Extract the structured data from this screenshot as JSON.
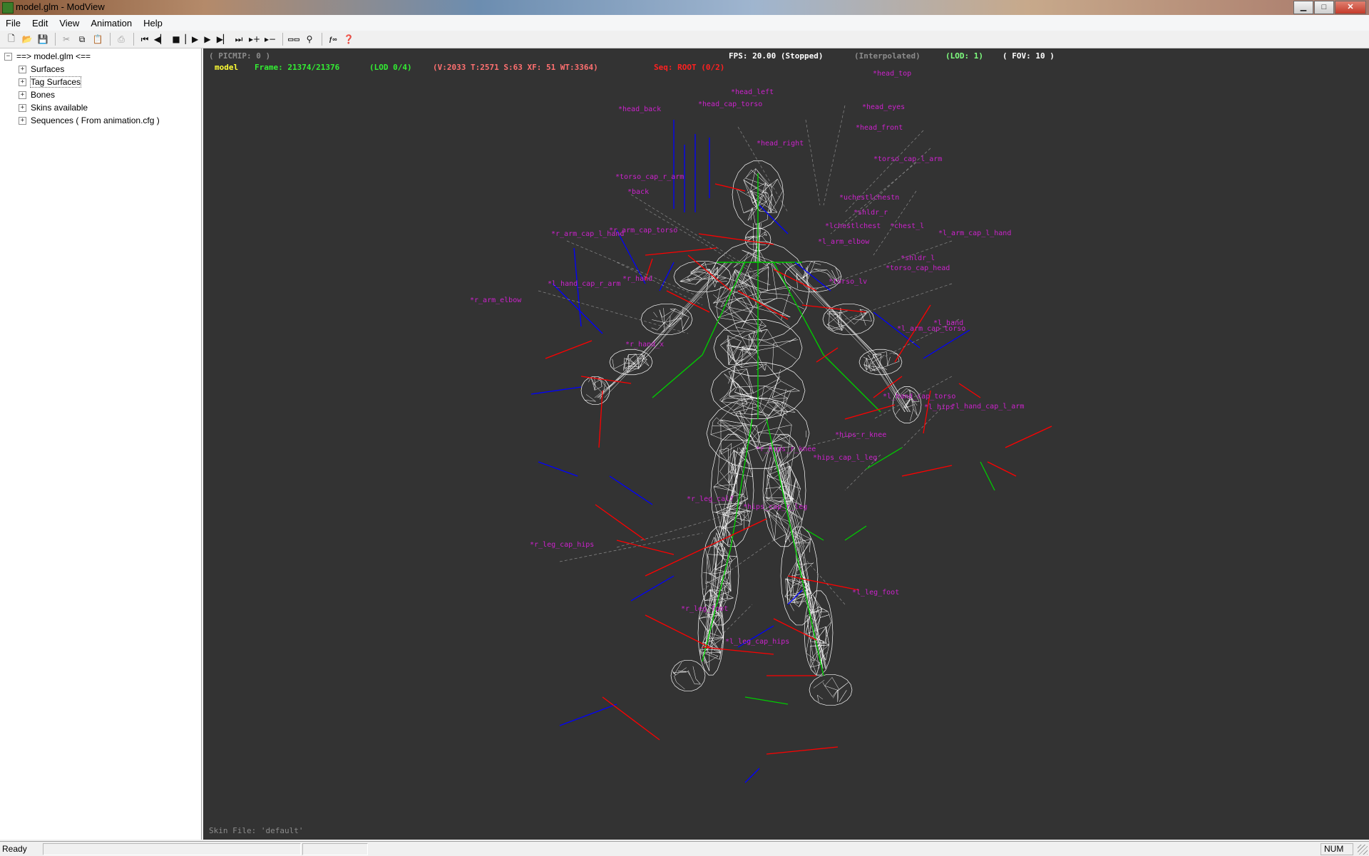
{
  "window": {
    "title": "model.glm - ModView",
    "minimize": "▁",
    "maximize": "□",
    "close": "✕"
  },
  "menu": [
    "File",
    "Edit",
    "View",
    "Animation",
    "Help"
  ],
  "toolbar": [
    "new-icon",
    "open-icon",
    "save-icon",
    "cut-icon",
    "copy-icon",
    "paste-icon",
    "print-icon",
    "first-frame-icon",
    "prev-frame-icon",
    "stop-icon",
    "play-icon",
    "play-forward-icon",
    "next-frame-icon",
    "last-frame-icon",
    "add-frame-icon",
    "remove-frame-icon",
    "bbox-icon",
    "skeleton-icon",
    "fov-icon",
    "help-icon"
  ],
  "tree": {
    "root": "==> model.glm <==",
    "items": [
      "Surfaces",
      "Tag Surfaces",
      "Bones",
      "Skins available",
      "Sequences ( From animation.cfg )"
    ]
  },
  "hud": {
    "picmip": "( PICMIP: 0 )",
    "fps": "FPS: 20.00 (Stopped)",
    "interp": "(Interpolated)",
    "lod_top": "(LOD: 1)",
    "fov": "( FOV: 10 )",
    "model": "model",
    "frame": "Frame: 21374/21376",
    "lod": "(LOD 0/4)",
    "stats": "(V:2033 T:2571 S:63 XF: 51 WT:3364)",
    "seq": "Seq: ROOT (0/2)",
    "skin": "Skin File: 'default'"
  },
  "tags": [
    "*head_top",
    "*head_left",
    "*head_cap_torso",
    "*head_back",
    "*head_eyes",
    "*head_front",
    "*head_right",
    "*torso_cap_l_arm",
    "*torso_cap_r_arm",
    "*back",
    "*uchestlchestn",
    "*shldr_r",
    "*lchestlchest",
    "*chest_l",
    "*r_arm_cap_l_hand",
    "*r_arm_cap_torso",
    "*l_arm_cap_l_hand",
    "*l_arm_elbow",
    "*shldr_l",
    "*torso_cap_head",
    "*r_hand",
    "*l_hand_cap_r_arm",
    "*r_arm_elbow",
    "*torso_lv",
    "*l_hand",
    "*l_arm_cap_torso",
    "*r_hand_x",
    "*l_hand_cap_torso",
    "*l_hand_cap_l_arm",
    "*r_hips_r_knee",
    "*hips_r_knee",
    "*hips_cap_l_leg",
    "*r_leg_calf",
    "*hips_cap_r_leg",
    "*r_leg_cap_hips",
    "*l_leg_foot",
    "*r_leg_foot",
    "*l_leg_cap_hips",
    "*l_hips"
  ],
  "colors": {
    "viewport_bg": "#333333",
    "wire": "#ffffff",
    "bone_red": "#ff0000",
    "bone_green": "#00cc00",
    "bone_blue": "#0000ff",
    "tag_label": "#cc22cc"
  },
  "status": {
    "text": "Ready",
    "num": "NUM"
  }
}
